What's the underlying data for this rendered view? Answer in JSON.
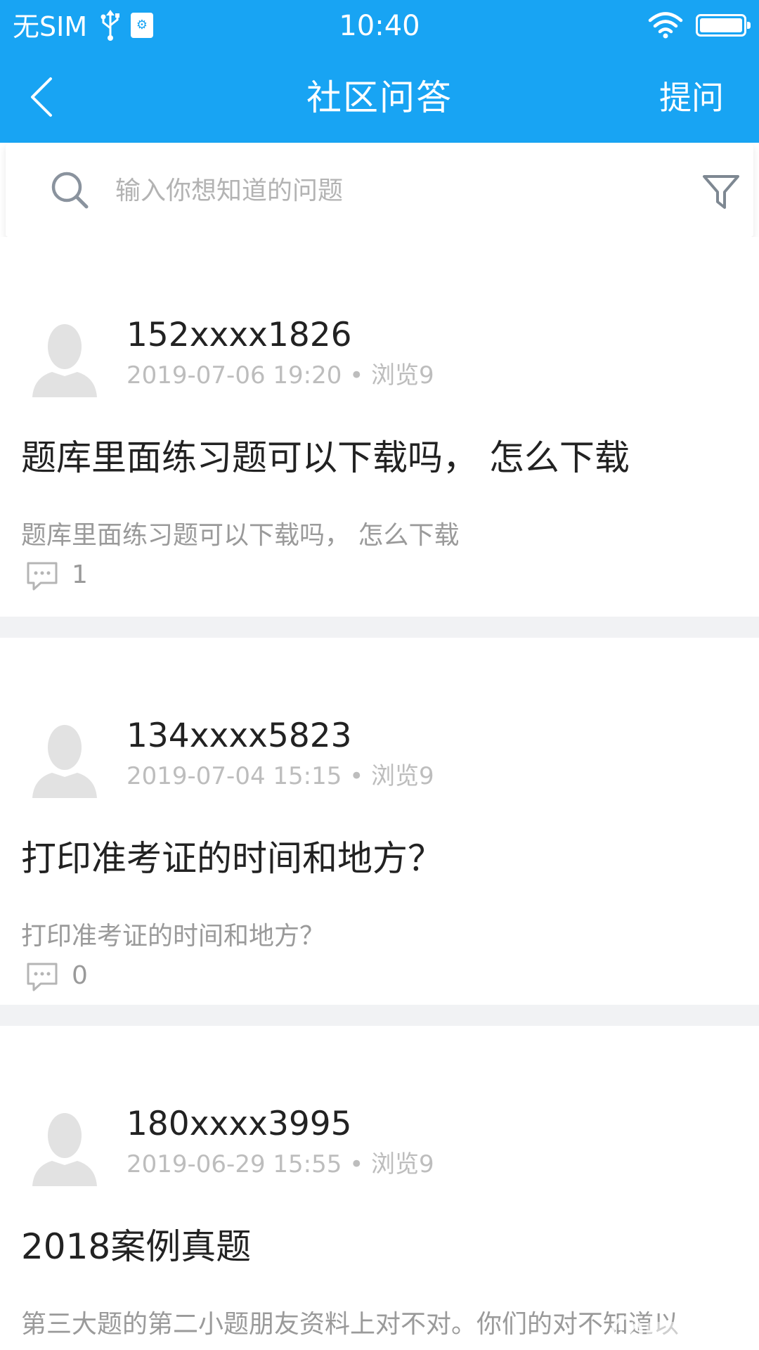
{
  "status_bar": {
    "carrier": "无SIM",
    "time": "10:40"
  },
  "nav": {
    "title": "社区问答",
    "right_action": "提问"
  },
  "search": {
    "placeholder": "输入你想知道的问题"
  },
  "posts": [
    {
      "user": "152xxxx1826",
      "meta": "2019-07-06 19:20 • 浏览9",
      "title": "题库里面练习题可以下载吗， 怎么下载",
      "description": "题库里面练习题可以下载吗， 怎么下载",
      "comments": "1"
    },
    {
      "user": "134xxxx5823",
      "meta": "2019-07-04 15:15 • 浏览9",
      "title": "打印准考证的时间和地方？",
      "description": "打印准考证的时间和地方？",
      "comments": "0"
    },
    {
      "user": "180xxxx3995",
      "meta": "2019-06-29 15:55 • 浏览9",
      "title": "2018案例真题",
      "description": "第三大题的第二小题朋友资料上对不对。你们的对不知道以"
    }
  ],
  "colors": {
    "header": "#18a4f3",
    "separator": "#f1f2f4",
    "meta_text": "#bdbdbd"
  },
  "icons": [
    "back-arrow-icon",
    "search-icon",
    "filter-icon",
    "avatar-icon",
    "comment-icon",
    "wifi-icon",
    "battery-icon",
    "usb-icon"
  ]
}
